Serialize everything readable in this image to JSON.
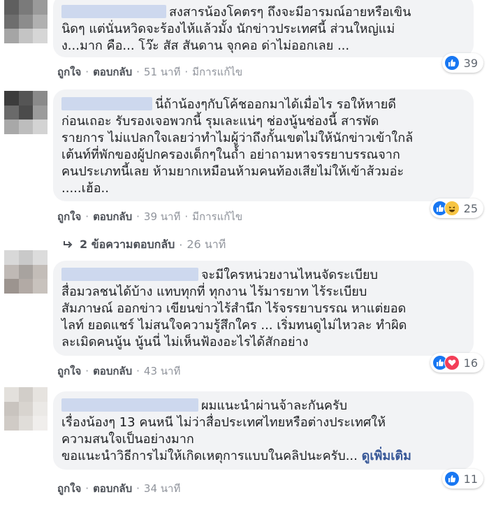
{
  "comments": [
    {
      "text": "สงสารน้องโคตรๆ ถึงจะมีอารมณ์อายหรือเขิน\nนิดๆ แต่นั่นหวิดจะร้องไห้แล้วมั้ง นักข่าวประเทศนี้ ส่วนใหญ่แม่\nง...มาก คือ... โว๊ะ สัส สันดาน จุกคอ ด่าไม่ออกเลย ...",
      "like": "ถูกใจ",
      "reply": "ตอบกลับ",
      "time": "51 นาที",
      "edited": "มีการแก้ไข",
      "reactions": [
        "like"
      ],
      "count": "39"
    },
    {
      "text": "นี่ถ้าน้องๆกับโค้ชออกมาได้เมื่อไร รอให้หายดี\nก่อนเถอะ รับรองเจอพวกนี้ รุมเละแน่ๆ ช่องนู้นช่องนี้ สารพัด\nรายการ ไม่แปลกใจเลยว่าทำไมผู้ว่าถึงกั้นเขตไม่ให้นักข่าวเข้าใกล้\nเต้นท์ที่พักของผู้ปกครองเด็กๆในถ้ำ อย่าถามหาจรรยาบรรณจาก\nคนประเภทนี้เลย ห้ามยากเหมือนห้ามคนท้องเสียไม่ให้เข้าส้วมอ่ะ\n.....เฮ้อ..",
      "like": "ถูกใจ",
      "reply": "ตอบกลับ",
      "time": "39 นาที",
      "edited": "มีการแก้ไข",
      "reactions": [
        "like",
        "haha"
      ],
      "count": "25"
    },
    {
      "text": "จะมีใครหน่วยงานไหนจัดระเบียบ\nสื่อมวลชนได้บ้าง แทบทุกที่ ทุกงาน ไร้มารยาท ไร้ระเบียบ\nสัมภาษณ์ ออกข่าว เขียนข่าวไร้สำนึก ไร้จรรยาบรรณ หาแต่ยอด\nไลท์ ยอดแชร์ ไม่สนใจความรู้สึกใคร ... เริ่มทนดูไม่ไหวละ ทำผิด\nละเมิดคนนู้น นู้นนี่ ไม่เห็นฟ้องอะไรได้สักอย่าง",
      "like": "ถูกใจ",
      "reply": "ตอบกลับ",
      "time": "43 นาที",
      "reactions": [
        "like",
        "love"
      ],
      "count": "16"
    },
    {
      "text": "ผมแนะนำผ่านจ้าละกันครับ\nเรื่องน้องๆ 13 คนหนี ไม่ว่าสื่อประเทศไทยหรือต่างประเทศให้\nความสนใจเป็นอย่างมาก\nขอแนะนำวิธีการไม่ให้เกิดเหตุการแบบในคลิปนะครับ...",
      "see_more": "ดูเพิ่มเติม",
      "like": "ถูกใจ",
      "reply": "ตอบกลับ",
      "time": "34 นาที",
      "reactions": [
        "like"
      ],
      "count": "11"
    }
  ],
  "replies_link": {
    "label": "2 ข้อความตอบกลับ",
    "time": "26 นาที"
  },
  "colors": {
    "like": "#1877f2",
    "haha": "#f7c544",
    "love": "#f33e58",
    "bubble": "#f2f3f5",
    "link": "#385898"
  }
}
